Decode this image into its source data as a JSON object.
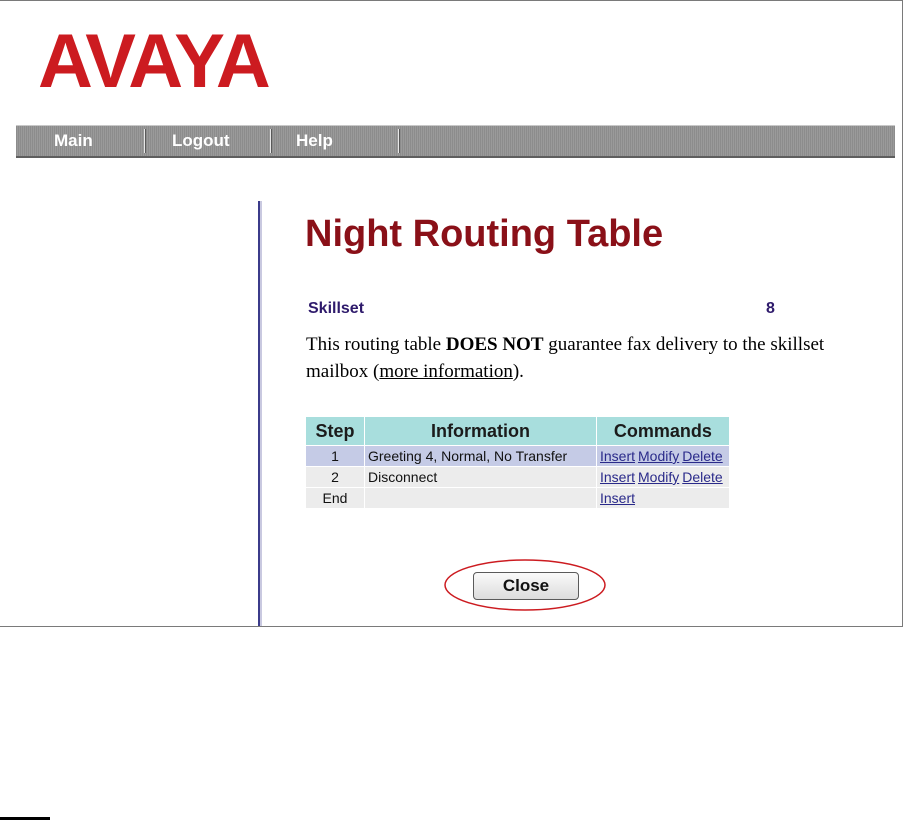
{
  "brand": {
    "logo_text": "AVAYA",
    "color": "#cc1b20"
  },
  "nav": {
    "items": [
      "Main",
      "Logout",
      "Help"
    ]
  },
  "page": {
    "title": "Night Routing Table",
    "skillset_label": "Skillset",
    "skillset_value": "8",
    "notice_pre": "This routing table ",
    "notice_bold": "DOES NOT",
    "notice_post": " guarantee fax delivery to the skillset mailbox (",
    "notice_link": "more information",
    "notice_end": ")."
  },
  "table": {
    "headers": [
      "Step",
      "Information",
      "Commands"
    ],
    "rows": [
      {
        "step": "1",
        "info": "Greeting 4, Normal, No Transfer",
        "commands": [
          "Insert",
          "Modify",
          "Delete"
        ]
      },
      {
        "step": "2",
        "info": "Disconnect",
        "commands": [
          "Insert",
          "Modify",
          "Delete"
        ]
      },
      {
        "step": "End",
        "info": "",
        "commands": [
          "Insert"
        ]
      }
    ]
  },
  "close_label": "Close",
  "colors": {
    "title": "#8a1018",
    "header_bg": "#a8dedd",
    "highlight_row": "#c5cbe6",
    "annotation": "#cc1b20"
  }
}
